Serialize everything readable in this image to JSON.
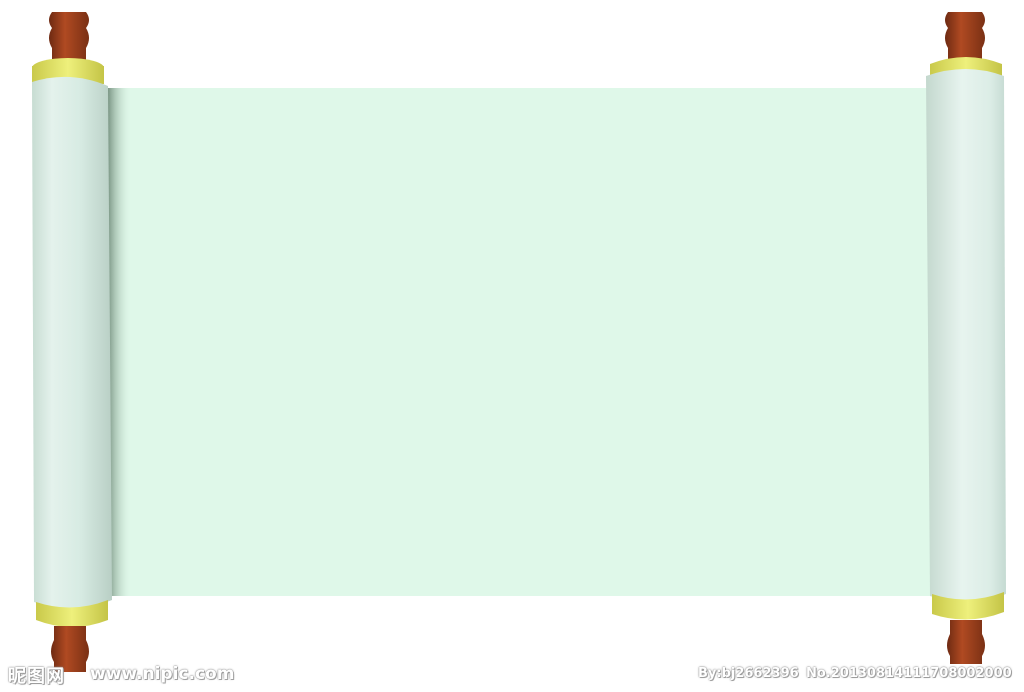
{
  "image": {
    "subject": "open scroll",
    "colors": {
      "paper": "#dff8e9",
      "roll": "#d8ece4",
      "cuff": "#e6e870",
      "wood": "#9a3d1c",
      "background": "#ffffff"
    }
  },
  "watermark": {
    "brand": "昵图网",
    "url": "www.nipic.com",
    "author": "By:bj2662396",
    "number": "No.20130814111708002000"
  }
}
